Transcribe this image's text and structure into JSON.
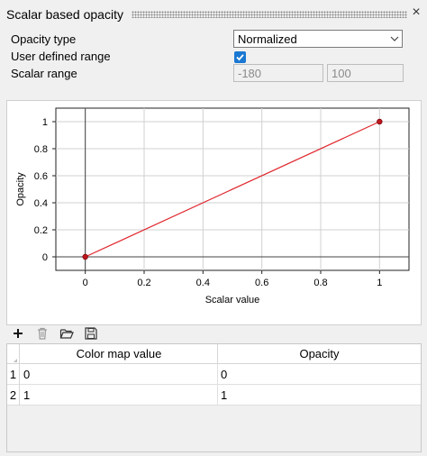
{
  "panel": {
    "title": "Scalar based opacity",
    "close_glyph": "×"
  },
  "form": {
    "opacity_type_label": "Opacity type",
    "opacity_type_value": "Normalized",
    "user_defined_range_label": "User defined range",
    "user_defined_range_checked": true,
    "scalar_range_label": "Scalar range",
    "scalar_range_min": "-180",
    "scalar_range_max": "100"
  },
  "chart_data": {
    "type": "line",
    "x": [
      0,
      1
    ],
    "y": [
      0,
      1
    ],
    "xlabel": "Scalar value",
    "ylabel": "Opacity",
    "xlim": [
      -0.1,
      1.1
    ],
    "ylim": [
      -0.1,
      1.1
    ],
    "xticks": [
      "0",
      "0.2",
      "0.4",
      "0.6",
      "0.8",
      "1"
    ],
    "yticks": [
      "0",
      "0.2",
      "0.4",
      "0.6",
      "0.8",
      "1"
    ],
    "grid": true,
    "line_color": "#e0262d",
    "marker_color": "#c0161d"
  },
  "toolbar": {
    "icons": [
      "add-icon",
      "delete-icon",
      "open-folder-icon",
      "save-icon"
    ]
  },
  "table": {
    "columns": [
      "Color map value",
      "Opacity"
    ],
    "rows": [
      {
        "num": "1",
        "cells": [
          "0",
          "0"
        ]
      },
      {
        "num": "2",
        "cells": [
          "1",
          "1"
        ]
      }
    ]
  }
}
